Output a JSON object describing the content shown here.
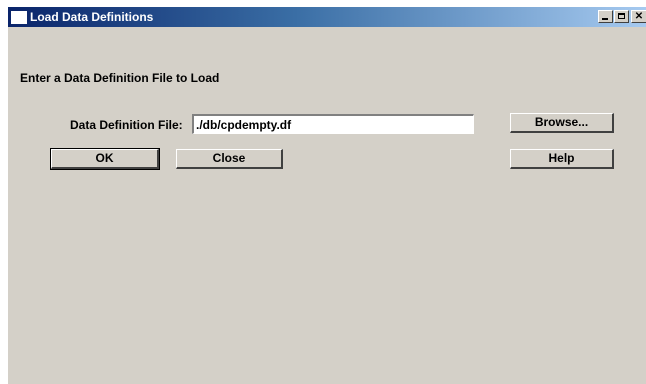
{
  "window": {
    "title": "Load Data Definitions",
    "controls": {
      "minimize": "minimize",
      "maximize": "maximize",
      "close": "close"
    }
  },
  "form": {
    "prompt": "Enter a Data Definition File to Load",
    "file_label": "Data Definition File:",
    "file_value": "./db/cpdempty.df"
  },
  "buttons": {
    "browse": "Browse...",
    "ok": "OK",
    "close": "Close",
    "help": "Help"
  },
  "colors": {
    "face": "#d4d0c8",
    "title_start": "#0a246a",
    "title_end": "#a6caf0"
  }
}
